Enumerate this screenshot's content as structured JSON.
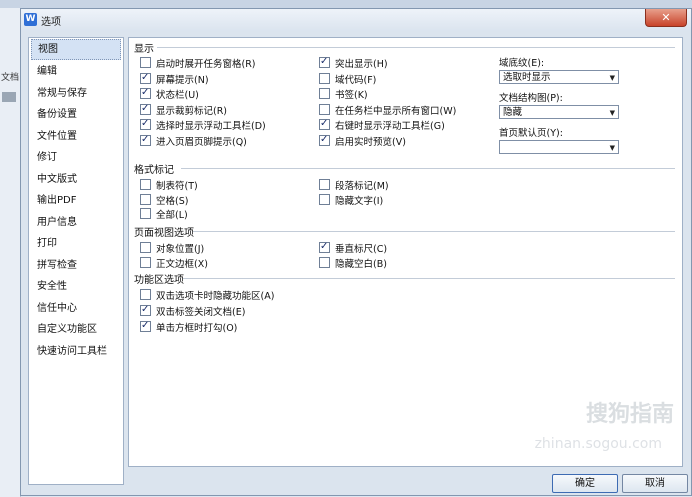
{
  "window": {
    "title": "选项",
    "close_label": "✕",
    "app_icon": "W"
  },
  "background": {
    "side_label": "文档"
  },
  "sidebar": {
    "items": [
      {
        "label": "视图",
        "selected": true
      },
      {
        "label": "编辑"
      },
      {
        "label": "常规与保存"
      },
      {
        "label": "备份设置"
      },
      {
        "label": "文件位置"
      },
      {
        "label": "修订"
      },
      {
        "label": "中文版式"
      },
      {
        "label": "输出PDF"
      },
      {
        "label": "用户信息"
      },
      {
        "label": "打印"
      },
      {
        "label": "拼写检查"
      },
      {
        "label": "安全性"
      },
      {
        "label": "信任中心"
      },
      {
        "label": "自定义功能区"
      },
      {
        "label": "快速访问工具栏"
      }
    ]
  },
  "display": {
    "heading": "显示",
    "left": [
      {
        "label": "启动时展开任务窗格(R)",
        "checked": false
      },
      {
        "label": "屏幕提示(N)",
        "checked": true
      },
      {
        "label": "状态栏(U)",
        "checked": true
      },
      {
        "label": "显示裁剪标记(R)",
        "checked": true
      },
      {
        "label": "选择时显示浮动工具栏(D)",
        "checked": true
      },
      {
        "label": "进入页眉页脚提示(Q)",
        "checked": true
      }
    ],
    "middle": [
      {
        "label": "突出显示(H)",
        "checked": true
      },
      {
        "label": "域代码(F)",
        "checked": false
      },
      {
        "label": "书签(K)",
        "checked": false
      },
      {
        "label": "在任务栏中显示所有窗口(W)",
        "checked": false
      },
      {
        "label": "右键时显示浮动工具栏(G)",
        "checked": true
      },
      {
        "label": "启用实时预览(V)",
        "checked": true
      }
    ],
    "shading_label": "域底纹(E):",
    "shading_value": "选取时显示",
    "docmap_label": "文档结构图(P):",
    "docmap_value": "隐藏",
    "firstpage_label": "首页默认页(Y):",
    "firstpage_value": ""
  },
  "format_marks": {
    "heading": "格式标记",
    "left": [
      {
        "label": "制表符(T)",
        "checked": false
      },
      {
        "label": "空格(S)",
        "checked": false
      },
      {
        "label": "全部(L)",
        "checked": false
      }
    ],
    "middle": [
      {
        "label": "段落标记(M)",
        "checked": false
      },
      {
        "label": "隐藏文字(I)",
        "checked": false
      }
    ]
  },
  "page_view": {
    "heading": "页面视图选项",
    "left": [
      {
        "label": "对象位置(J)",
        "checked": false
      },
      {
        "label": "正文边框(X)",
        "checked": false
      }
    ],
    "middle": [
      {
        "label": "垂直标尺(C)",
        "checked": true
      },
      {
        "label": "隐藏空白(B)",
        "checked": false
      }
    ]
  },
  "ribbon": {
    "heading": "功能区选项",
    "items": [
      {
        "label": "双击选项卡时隐藏功能区(A)",
        "checked": false
      },
      {
        "label": "双击标签关闭文档(E)",
        "checked": true
      },
      {
        "label": "单击方框时打勾(O)",
        "checked": true
      }
    ]
  },
  "buttons": {
    "ok": "确定",
    "cancel": "取消"
  },
  "watermark": {
    "text": "搜狗指南",
    "url": "zhinan.sogou.com"
  }
}
